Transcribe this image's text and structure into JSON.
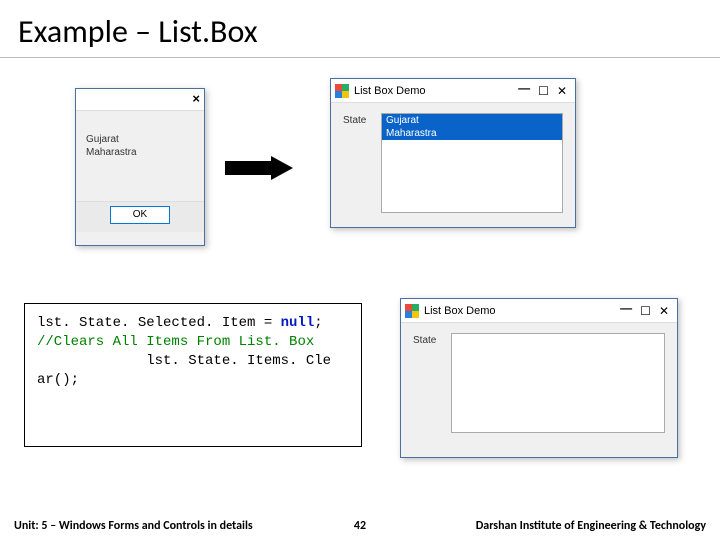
{
  "title": "Example – List.Box",
  "msgbox": {
    "close": "×",
    "line1": "Gujarat",
    "line2": "Maharastra",
    "ok": "OK"
  },
  "win1": {
    "title": "List Box Demo",
    "min": "—",
    "max": "☐",
    "close": "✕",
    "label": "State",
    "item1": "Gujarat",
    "item2": "Maharastra"
  },
  "win2": {
    "title": "List Box Demo",
    "min": "—",
    "max": "☐",
    "close": "✕",
    "label": "State"
  },
  "code": {
    "l1a": "lst. State. Selected. Item = ",
    "l1b": "null",
    "l1c": ";",
    "l2": "//Clears All Items From List. Box",
    "l3": "             lst. State. Items. Cle",
    "l4": "ar();"
  },
  "footer": {
    "left": "Unit: 5 – Windows Forms and Controls in details",
    "mid": "42",
    "right": "Darshan Institute of Engineering & Technology"
  }
}
